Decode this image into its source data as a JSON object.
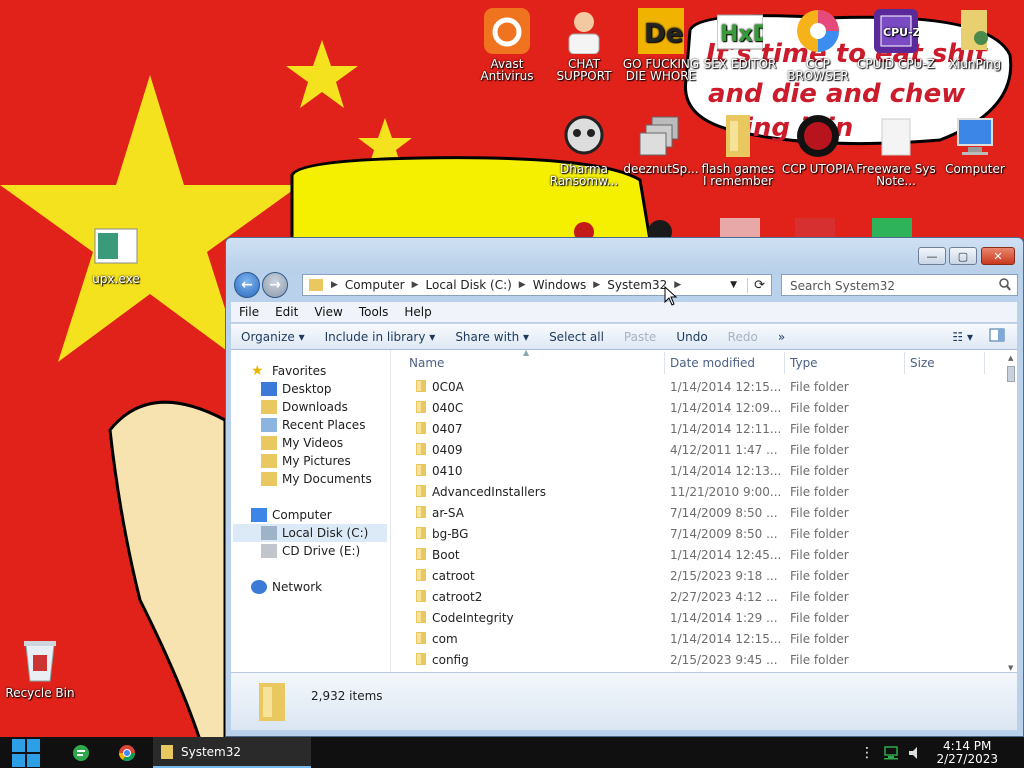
{
  "desktop": {
    "icons": [
      {
        "label": "upx.exe",
        "icon": "exe-icon"
      },
      {
        "label": "Avast Antivirus",
        "icon": "avast-icon"
      },
      {
        "label": "CHAT SUPPORT",
        "icon": "doctor-icon"
      },
      {
        "label": "GO FUCKING DIE WHORE",
        "icon": "die-icon"
      },
      {
        "label": "SEX EDITOR",
        "icon": "hxd-icon"
      },
      {
        "label": "CCP BROWSER",
        "icon": "browser-icon"
      },
      {
        "label": "CPUID CPU-Z",
        "icon": "cpuz-icon"
      },
      {
        "label": "XiunPing",
        "icon": "user-folder-icon"
      },
      {
        "label": "Dharma Ransomw...",
        "icon": "skull-icon"
      },
      {
        "label": "deeznutSp...",
        "icon": "windows-stack-icon"
      },
      {
        "label": "flash games I remember",
        "icon": "folder-icon"
      },
      {
        "label": "CCP UTOPIA",
        "icon": "ccp-utopia-icon"
      },
      {
        "label": "Freeware Sys Note...",
        "icon": "blank-doc-icon"
      },
      {
        "label": "Computer",
        "icon": "computer-icon"
      },
      {
        "label": "Recycle Bin",
        "icon": "recycle-bin-icon"
      }
    ],
    "wallpaper_text": [
      "It's time to eat shit",
      "and die and chew",
      "ing illin"
    ]
  },
  "explorer": {
    "title_buttons": {
      "minimize": "—",
      "maximize": "▢",
      "close": "✕"
    },
    "nav": {
      "back": "←",
      "forward": "→"
    },
    "address": [
      "Computer",
      "Local Disk (C:)",
      "Windows",
      "System32"
    ],
    "search_placeholder": "Search System32",
    "menu": [
      "File",
      "Edit",
      "View",
      "Tools",
      "Help"
    ],
    "commands": {
      "organize": "Organize",
      "include": "Include in library",
      "share": "Share with",
      "select_all": "Select all",
      "paste": "Paste",
      "undo": "Undo",
      "redo": "Redo",
      "more": "»"
    },
    "navpane": {
      "favorites": "Favorites",
      "favorites_items": [
        "Desktop",
        "Downloads",
        "Recent Places",
        "My Videos",
        "My Pictures",
        "My Documents"
      ],
      "computer": "Computer",
      "computer_items": [
        "Local Disk (C:)",
        "CD Drive (E:)"
      ],
      "network": "Network"
    },
    "columns": {
      "name": "Name",
      "date": "Date modified",
      "type": "Type",
      "size": "Size"
    },
    "files": [
      {
        "name": "0C0A",
        "date": "1/14/2014 12:15...",
        "type": "File folder"
      },
      {
        "name": "040C",
        "date": "1/14/2014 12:09...",
        "type": "File folder"
      },
      {
        "name": "0407",
        "date": "1/14/2014 12:11...",
        "type": "File folder"
      },
      {
        "name": "0409",
        "date": "4/12/2011 1:47 ...",
        "type": "File folder"
      },
      {
        "name": "0410",
        "date": "1/14/2014 12:13...",
        "type": "File folder"
      },
      {
        "name": "AdvancedInstallers",
        "date": "11/21/2010 9:00...",
        "type": "File folder"
      },
      {
        "name": "ar-SA",
        "date": "7/14/2009 8:50 ...",
        "type": "File folder"
      },
      {
        "name": "bg-BG",
        "date": "7/14/2009 8:50 ...",
        "type": "File folder"
      },
      {
        "name": "Boot",
        "date": "1/14/2014 12:45...",
        "type": "File folder"
      },
      {
        "name": "catroot",
        "date": "2/15/2023 9:18 ...",
        "type": "File folder"
      },
      {
        "name": "catroot2",
        "date": "2/27/2023 4:12 ...",
        "type": "File folder"
      },
      {
        "name": "CodeIntegrity",
        "date": "1/14/2014 1:29 ...",
        "type": "File folder"
      },
      {
        "name": "com",
        "date": "1/14/2014 12:15...",
        "type": "File folder"
      },
      {
        "name": "config",
        "date": "2/15/2023 9:45 ...",
        "type": "File folder"
      }
    ],
    "item_count": "2,932 items"
  },
  "taskbar": {
    "window_label": "System32",
    "time": "4:14 PM",
    "date": "2/27/2023"
  }
}
